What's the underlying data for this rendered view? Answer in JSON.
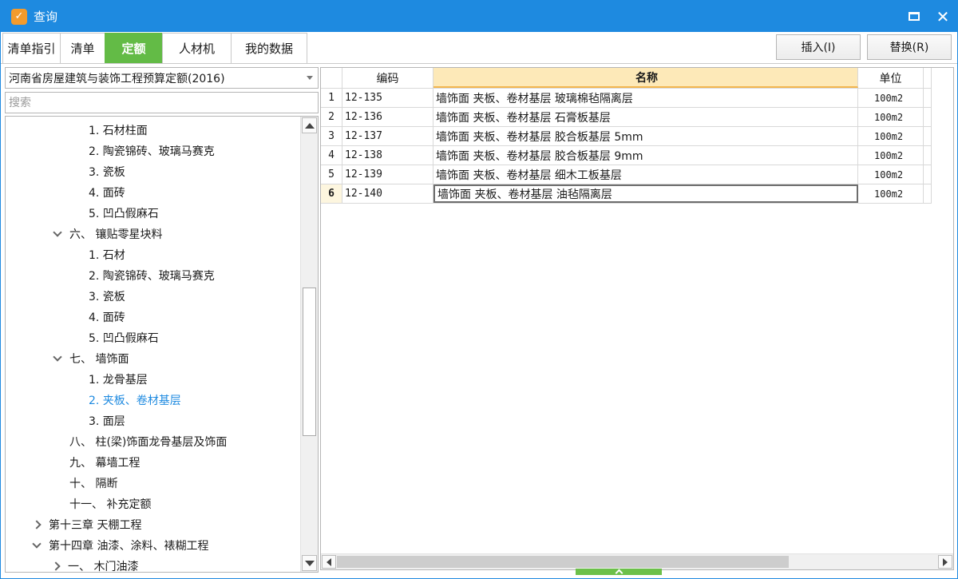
{
  "window": {
    "title": "查询"
  },
  "toolbar": {
    "tabs": [
      {
        "label": "清单指引"
      },
      {
        "label": "清单"
      },
      {
        "label": "定额"
      },
      {
        "label": "人材机"
      },
      {
        "label": "我的数据"
      }
    ],
    "active_tab": "定额",
    "insert_label": "插入(I)",
    "replace_label": "替换(R)"
  },
  "left": {
    "quota_select": "河南省房屋建筑与装饰工程预算定额(2016)",
    "search_placeholder": "搜索",
    "tree": [
      {
        "label": "1. 石材柱面"
      },
      {
        "label": "2. 陶瓷锦砖、玻璃马赛克"
      },
      {
        "label": "3. 瓷板"
      },
      {
        "label": "4. 面砖"
      },
      {
        "label": "5. 凹凸假麻石"
      },
      {
        "label": "六、 镶贴零星块料"
      },
      {
        "label": "1. 石材"
      },
      {
        "label": "2. 陶瓷锦砖、玻璃马赛克"
      },
      {
        "label": "3. 瓷板"
      },
      {
        "label": "4. 面砖"
      },
      {
        "label": "5. 凹凸假麻石"
      },
      {
        "label": "七、 墙饰面"
      },
      {
        "label": "1. 龙骨基层"
      },
      {
        "label": "2. 夹板、卷材基层"
      },
      {
        "label": "3. 面层"
      },
      {
        "label": "八、 柱(梁)饰面龙骨基层及饰面"
      },
      {
        "label": "九、 幕墙工程"
      },
      {
        "label": "十、 隔断"
      },
      {
        "label": "十一、 补充定额"
      },
      {
        "label": "第十三章 天棚工程"
      },
      {
        "label": "第十四章 油漆、涂料、裱糊工程"
      },
      {
        "label": "一、 木门油漆"
      }
    ]
  },
  "table": {
    "columns": {
      "code": "编码",
      "name": "名称",
      "unit": "单位"
    },
    "rows": [
      {
        "idx": "1",
        "code": "12-135",
        "name": "墙饰面 夹板、卷材基层 玻璃棉毡隔离层",
        "unit": "100m2"
      },
      {
        "idx": "2",
        "code": "12-136",
        "name": "墙饰面 夹板、卷材基层 石膏板基层",
        "unit": "100m2"
      },
      {
        "idx": "3",
        "code": "12-137",
        "name": "墙饰面 夹板、卷材基层 胶合板基层 5mm",
        "unit": "100m2"
      },
      {
        "idx": "4",
        "code": "12-138",
        "name": "墙饰面 夹板、卷材基层 胶合板基层 9mm",
        "unit": "100m2"
      },
      {
        "idx": "5",
        "code": "12-139",
        "name": "墙饰面 夹板、卷材基层 细木工板基层",
        "unit": "100m2"
      },
      {
        "idx": "6",
        "code": "12-140",
        "name": "墙饰面 夹板、卷材基层 油毡隔离层",
        "unit": "100m2"
      }
    ]
  },
  "colors": {
    "titlebar": "#1e8ae0",
    "active_tab": "#63bb46",
    "selected_tree_text": "#1e8ae0",
    "header_highlight": "#fde9b8"
  }
}
